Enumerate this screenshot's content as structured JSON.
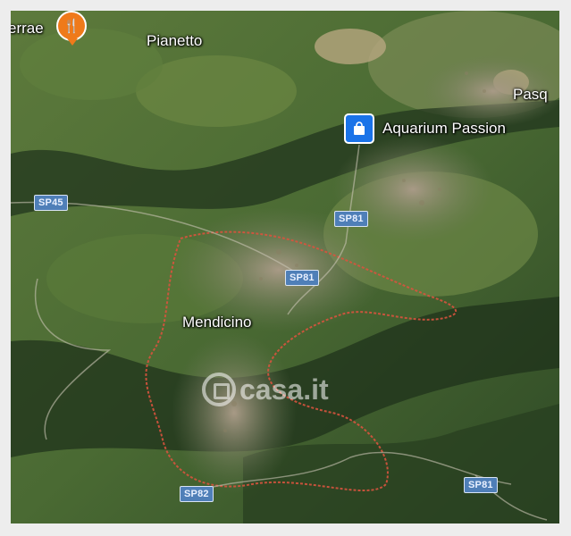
{
  "map": {
    "type": "satellite",
    "places": [
      {
        "id": "terrae",
        "label": "errae"
      },
      {
        "id": "pianetto",
        "label": "Pianetto"
      },
      {
        "id": "pasq",
        "label": "Pasq"
      },
      {
        "id": "mendicino",
        "label": "Mendicino"
      }
    ],
    "pois": [
      {
        "id": "restaurant",
        "icon": "fork-knife-icon",
        "color": "#ef7a1a"
      },
      {
        "id": "aquarium",
        "label": "Aquarium Passion",
        "icon": "shopping-bag-icon",
        "color": "#1a73e8"
      }
    ],
    "roads": {
      "sp45": "SP45",
      "sp81_north": "SP81",
      "sp81_center": "SP81",
      "sp82": "SP82",
      "sp81_east": "SP81"
    },
    "watermark": {
      "text": "casa.it"
    }
  }
}
